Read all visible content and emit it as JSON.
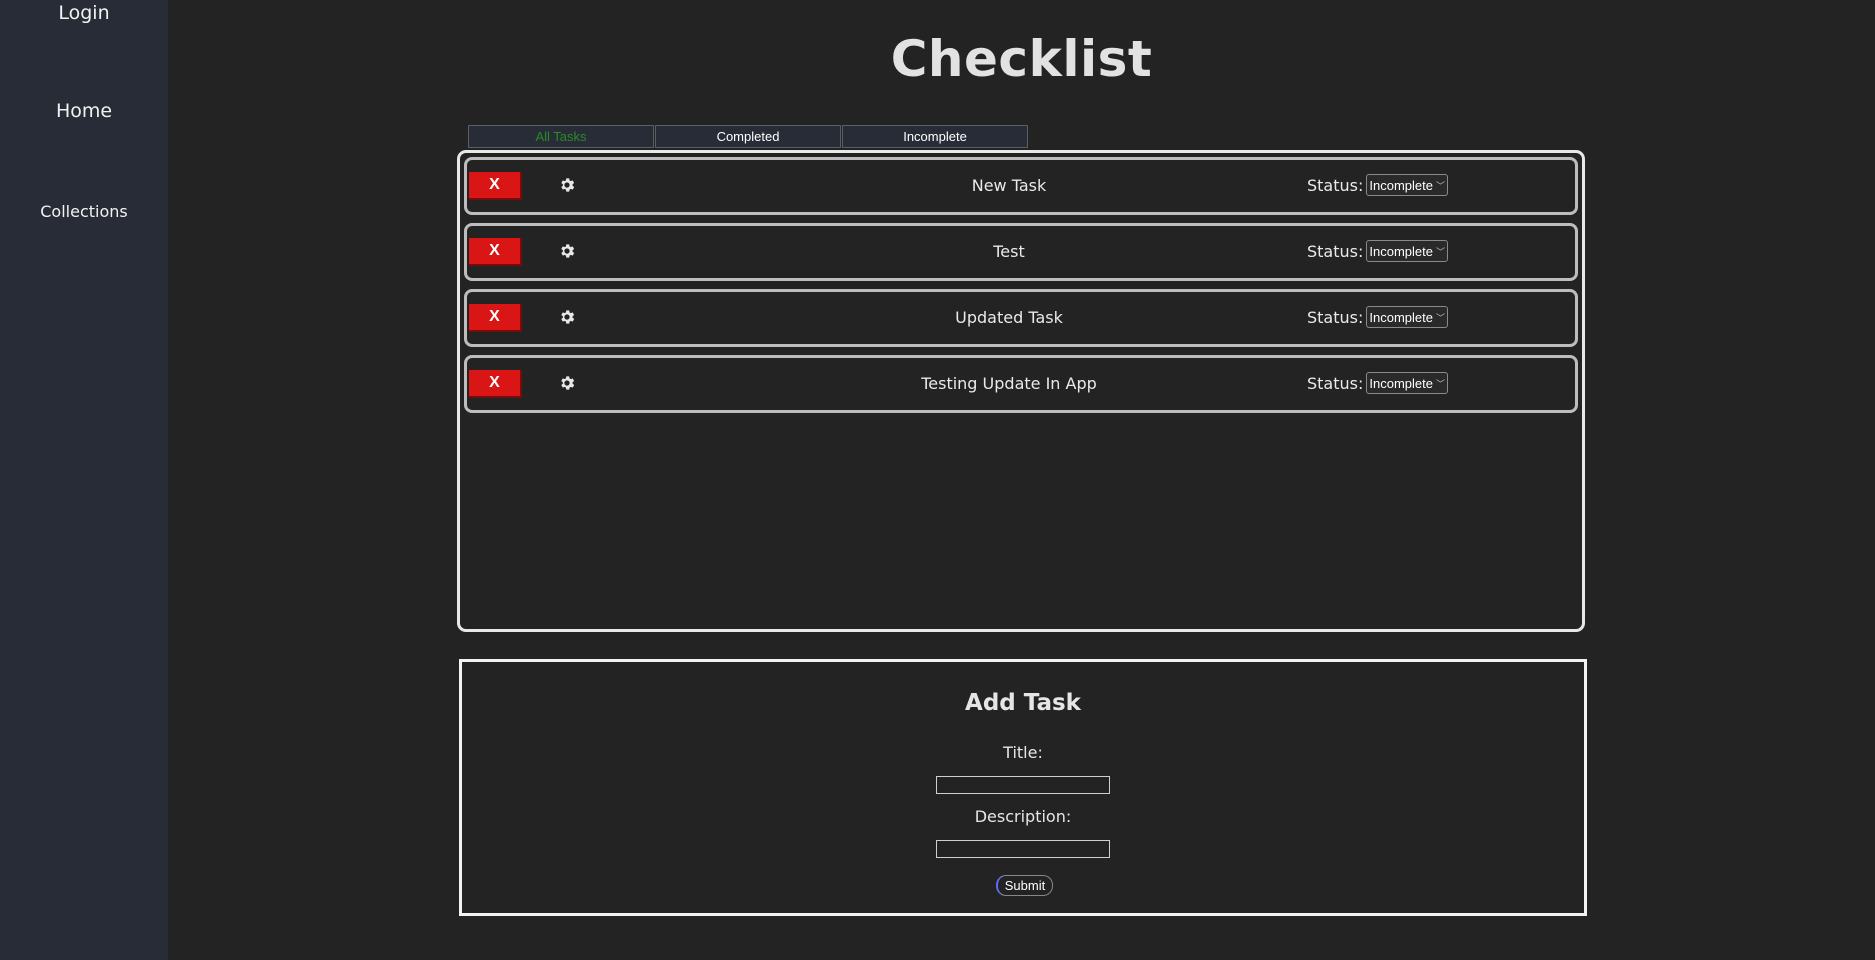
{
  "nav": {
    "login": "Login",
    "home": "Home",
    "collections": "Collections"
  },
  "page_title": "Checklist",
  "filters": [
    {
      "label": "All Tasks",
      "active": true
    },
    {
      "label": "Completed",
      "active": false
    },
    {
      "label": "Incomplete",
      "active": false
    }
  ],
  "tasks": [
    {
      "delete_label": "X",
      "title": "New Task",
      "status_label": "Status:",
      "status_value": "Incomplete"
    },
    {
      "delete_label": "X",
      "title": "Test",
      "status_label": "Status:",
      "status_value": "Incomplete"
    },
    {
      "delete_label": "X",
      "title": "Updated Task",
      "status_label": "Status:",
      "status_value": "Incomplete"
    },
    {
      "delete_label": "X",
      "title": "Testing Update In App",
      "status_label": "Status:",
      "status_value": "Incomplete"
    }
  ],
  "add_task": {
    "heading": "Add Task",
    "title_label": "Title:",
    "title_value": "",
    "description_label": "Description:",
    "description_value": "",
    "submit_label": "Submit"
  },
  "colors": {
    "background": "#232323",
    "sidebar": "#272c36",
    "delete": "#d91515",
    "active_filter": "#2a8a2a"
  },
  "icons": {
    "settings": "gear-icon",
    "dropdown": "chevron-down-icon"
  }
}
